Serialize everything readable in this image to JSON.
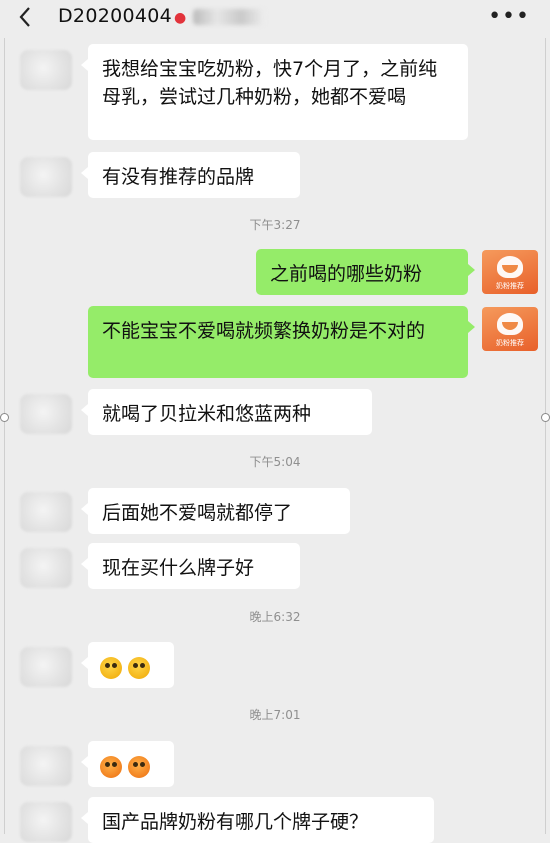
{
  "header": {
    "back_icon": "chevron-left-icon",
    "title": "D20200404",
    "title_icon": "balloon-icon",
    "more_icon": "more-dots-icon"
  },
  "app_avatar_caption": "奶粉推荐",
  "messages": [
    {
      "side": "left",
      "text": "我想给宝宝吃奶粉，快7个月了，之前纯母乳，尝试过几种奶粉，她都不爱喝"
    },
    {
      "side": "left",
      "text": "有没有推荐的品牌"
    },
    {
      "type": "time",
      "text": "下午3:27"
    },
    {
      "side": "right",
      "text": "之前喝的哪些奶粉"
    },
    {
      "side": "right",
      "text": "不能宝宝不爱喝就频繁换奶粉是不对的"
    },
    {
      "side": "left",
      "text": "就喝了贝拉米和悠蓝两种"
    },
    {
      "type": "time",
      "text": "下午5:04"
    },
    {
      "side": "left",
      "text": "后面她不爱喝就都停了"
    },
    {
      "side": "left",
      "text": "现在买什么牌子好"
    },
    {
      "type": "time",
      "text": "晚上6:32"
    },
    {
      "side": "left",
      "emoji": [
        "doge-emoji",
        "doge-emoji"
      ]
    },
    {
      "type": "time",
      "text": "晚上7:01"
    },
    {
      "side": "left",
      "emoji": [
        "shocked-emoji",
        "shocked-emoji"
      ]
    },
    {
      "side": "left",
      "text": "国产品牌奶粉有哪几个牌子硬？"
    }
  ]
}
